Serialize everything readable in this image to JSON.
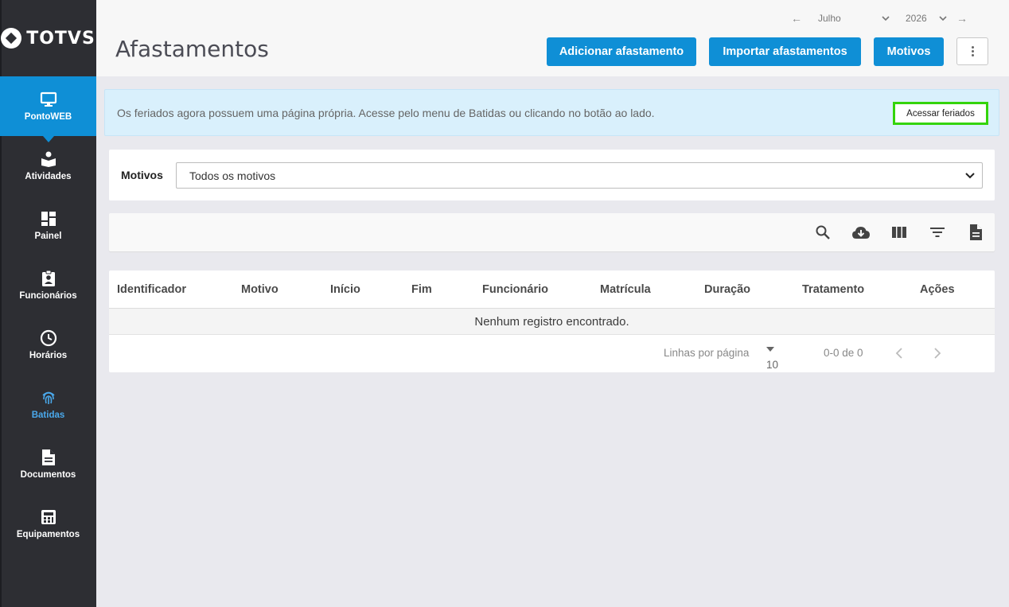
{
  "brand": {
    "logo_text": "TOTVS"
  },
  "sidebar": {
    "items": [
      {
        "label": "PontoWEB",
        "icon": "monitor-icon"
      },
      {
        "label": "Atividades",
        "icon": "reading-icon"
      },
      {
        "label": "Painel",
        "icon": "dashboard-icon"
      },
      {
        "label": "Funcionários",
        "icon": "badge-icon"
      },
      {
        "label": "Horários",
        "icon": "clock-icon"
      },
      {
        "label": "Batidas",
        "icon": "fingerprint-icon"
      },
      {
        "label": "Documentos",
        "icon": "document-icon"
      },
      {
        "label": "Equipamentos",
        "icon": "equipment-icon"
      }
    ]
  },
  "header": {
    "title": "Afastamentos",
    "period": {
      "month": "Julho",
      "year": "2026"
    },
    "buttons": {
      "add": "Adicionar afastamento",
      "import": "Importar afastamentos",
      "reasons": "Motivos"
    }
  },
  "banner": {
    "text": "Os feriados agora possuem uma página própria. Acesse pelo menu de Batidas ou clicando no botão ao lado.",
    "button": "Acessar feriados"
  },
  "filter": {
    "label": "Motivos",
    "selected": "Todos os motivos"
  },
  "table": {
    "columns": [
      "Identificador",
      "Motivo",
      "Início",
      "Fim",
      "Funcionário",
      "Matrícula",
      "Duração",
      "Tratamento",
      "Ações"
    ],
    "empty_message": "Nenhum registro encontrado.",
    "pagination": {
      "rows_label": "Linhas por página",
      "rows_value": "10",
      "range": "0-0 de 0"
    }
  },
  "colors": {
    "primary": "#0f8fd6",
    "sidebar": "#2d2e33",
    "highlight_border": "#34d40b",
    "banner_bg": "#d9f0fc"
  }
}
